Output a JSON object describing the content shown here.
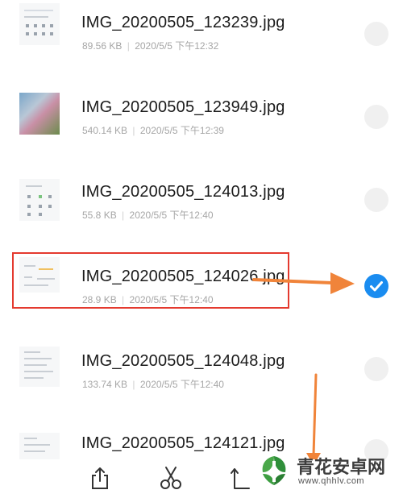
{
  "files": [
    {
      "name": "IMG_20200505_123239.jpg",
      "size": "89.56 KB",
      "date": "2020/5/5 下午12:32",
      "selected": false
    },
    {
      "name": "IMG_20200505_123949.jpg",
      "size": "540.14 KB",
      "date": "2020/5/5 下午12:39",
      "selected": false
    },
    {
      "name": "IMG_20200505_124013.jpg",
      "size": "55.8 KB",
      "date": "2020/5/5 下午12:40",
      "selected": false
    },
    {
      "name": "IMG_20200505_124026.jpg",
      "size": "28.9 KB",
      "date": "2020/5/5 下午12:40",
      "selected": true
    },
    {
      "name": "IMG_20200505_124048.jpg",
      "size": "133.74 KB",
      "date": "2020/5/5 下午12:40",
      "selected": false
    },
    {
      "name": "IMG_20200505_124121.jpg",
      "size": "",
      "date": "",
      "selected": false
    }
  ],
  "meta_separator": "|",
  "toolbar": {
    "icons": [
      "share-icon",
      "cut-icon",
      "copy-icon"
    ]
  },
  "watermark": {
    "title": "青花安卓网",
    "url": "www.qhhlv.com"
  },
  "colors": {
    "selected_check": "#1a8cf0",
    "highlight_box": "#e43a2f",
    "annotation_arrow": "#f0843a"
  }
}
